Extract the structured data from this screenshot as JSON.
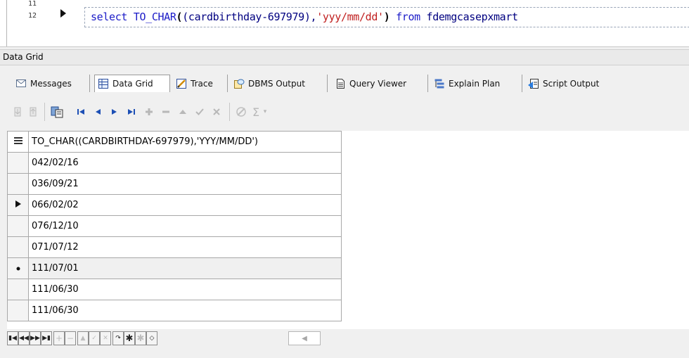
{
  "editor": {
    "line_numbers": [
      "11",
      "12"
    ],
    "code": {
      "kw_select": "select",
      "fn": "TO_CHAR",
      "open_brace": "(",
      "arg_pre": "(cardbirthday-697979),",
      "fmt": "'yyy/mm/dd'",
      "close_brace": ")",
      "kw_from": "from",
      "table": "fdemgcasepxmart"
    }
  },
  "panel_title": "Data Grid",
  "tabs": [
    {
      "label": "Messages",
      "icon": "messages-icon"
    },
    {
      "label": "Data Grid",
      "icon": "data-grid-icon",
      "active": true
    },
    {
      "label": "Trace",
      "icon": "trace-icon"
    },
    {
      "label": "DBMS Output",
      "icon": "dbms-output-icon"
    },
    {
      "label": "Query Viewer",
      "icon": "query-viewer-icon"
    },
    {
      "label": "Explain Plan",
      "icon": "explain-plan-icon"
    },
    {
      "label": "Script Output",
      "icon": "script-output-icon"
    }
  ],
  "grid": {
    "columns": [
      "TO_CHAR((CARDBIRTHDAY-697979),'YYY/MM/DD')"
    ],
    "rows": [
      "042/02/16",
      "036/09/21",
      "066/02/02",
      "076/12/10",
      "071/07/12",
      "111/07/01",
      "111/06/30",
      "111/06/30"
    ],
    "current_row": 3,
    "marked_row": 6
  },
  "colors": {
    "keyword": "#1c1cc8",
    "string": "#c02020",
    "identifier": "#000080"
  }
}
